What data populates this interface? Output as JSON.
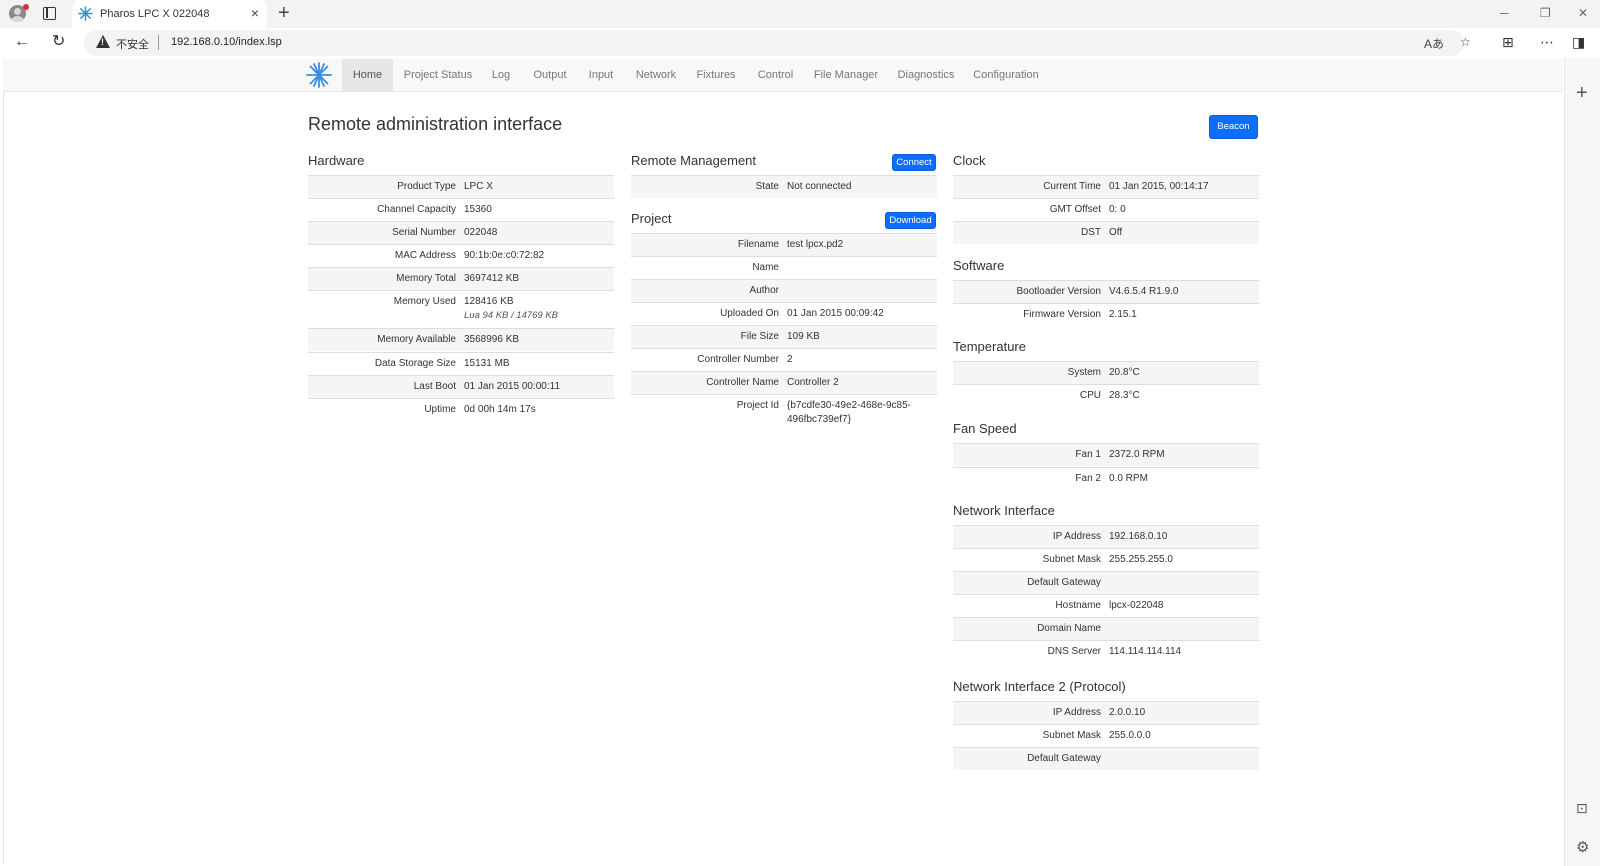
{
  "browser": {
    "tab_title": "Pharos LPC X 022048",
    "insecure_label": "不安全",
    "url": "192.168.0.10/index.lsp"
  },
  "nav": {
    "items": [
      {
        "label": "Home",
        "active": true
      },
      {
        "label": "Project Status"
      },
      {
        "label": "Log"
      },
      {
        "label": "Output"
      },
      {
        "label": "Input"
      },
      {
        "label": "Network"
      },
      {
        "label": "Fixtures"
      },
      {
        "label": "Control"
      },
      {
        "label": "File Manager"
      },
      {
        "label": "Diagnostics"
      },
      {
        "label": "Configuration"
      }
    ]
  },
  "page": {
    "title": "Remote administration interface",
    "beacon_label": "Beacon"
  },
  "hardware": {
    "title": "Hardware",
    "rows": [
      {
        "key": "Product Type",
        "value": "LPC X"
      },
      {
        "key": "Channel Capacity",
        "value": "15360"
      },
      {
        "key": "Serial Number",
        "value": "022048"
      },
      {
        "key": "MAC Address",
        "value": "90:1b:0e:c0:72:82"
      },
      {
        "key": "Memory Total",
        "value": "3697412 KB"
      },
      {
        "key": "Memory Used",
        "value": "128416 KB",
        "sub": "Lua 94 KB / 14769 KB"
      },
      {
        "key": "Memory Available",
        "value": "3568996 KB"
      },
      {
        "key": "Data Storage Size",
        "value": "15131 MB"
      },
      {
        "key": "Last Boot",
        "value": "01 Jan 2015 00:00:11"
      },
      {
        "key": "Uptime",
        "value": "0d 00h 14m 17s"
      }
    ]
  },
  "remote": {
    "title": "Remote Management",
    "connect_label": "Connect",
    "rows": [
      {
        "key": "State",
        "value": "Not connected"
      }
    ]
  },
  "project": {
    "title": "Project",
    "download_label": "Download",
    "rows": [
      {
        "key": "Filename",
        "value": "test lpcx.pd2"
      },
      {
        "key": "Name",
        "value": ""
      },
      {
        "key": "Author",
        "value": ""
      },
      {
        "key": "Uploaded On",
        "value": "01 Jan 2015 00:09:42"
      },
      {
        "key": "File Size",
        "value": "109 KB"
      },
      {
        "key": "Controller Number",
        "value": "2"
      },
      {
        "key": "Controller Name",
        "value": "Controller 2"
      },
      {
        "key": "Project Id",
        "value": "{b7cdfe30-49e2-468e-9c85-",
        "sub": "496fbc739ef7}"
      }
    ]
  },
  "clock": {
    "title": "Clock",
    "rows": [
      {
        "key": "Current Time",
        "value": "01 Jan 2015, 00:14:17"
      },
      {
        "key": "GMT Offset",
        "value": "0: 0"
      },
      {
        "key": "DST",
        "value": "Off"
      }
    ]
  },
  "software": {
    "title": "Software",
    "rows": [
      {
        "key": "Bootloader Version",
        "value": "V4.6.5.4 R1.9.0"
      },
      {
        "key": "Firmware Version",
        "value": "2.15.1"
      }
    ]
  },
  "temperature": {
    "title": "Temperature",
    "rows": [
      {
        "key": "System",
        "value": "20.8°C"
      },
      {
        "key": "CPU",
        "value": "28.3°C"
      }
    ]
  },
  "fan": {
    "title": "Fan Speed",
    "rows": [
      {
        "key": "Fan 1",
        "value": "2372.0 RPM"
      },
      {
        "key": "Fan 2",
        "value": "0.0 RPM"
      }
    ]
  },
  "net1": {
    "title": "Network Interface",
    "rows": [
      {
        "key": "IP Address",
        "value": "192.168.0.10"
      },
      {
        "key": "Subnet Mask",
        "value": "255.255.255.0"
      },
      {
        "key": "Default Gateway",
        "value": ""
      },
      {
        "key": "Hostname",
        "value": "lpcx-022048"
      },
      {
        "key": "Domain Name",
        "value": ""
      },
      {
        "key": "DNS Server",
        "value": "114.114.114.114"
      }
    ]
  },
  "net2": {
    "title": "Network Interface 2 (Protocol)",
    "rows": [
      {
        "key": "IP Address",
        "value": "2.0.0.10"
      },
      {
        "key": "Subnet Mask",
        "value": "255.0.0.0"
      },
      {
        "key": "Default Gateway",
        "value": ""
      }
    ]
  }
}
